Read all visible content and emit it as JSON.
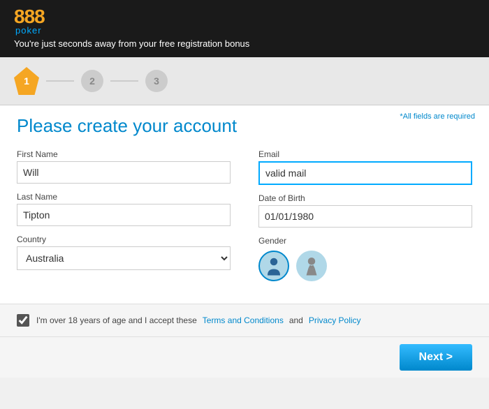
{
  "header": {
    "logo_888": "888",
    "logo_poker": "poker",
    "subtitle": "You're just seconds away from your free registration bonus"
  },
  "steps": {
    "step1": "1",
    "step2": "2",
    "step3": "3"
  },
  "form": {
    "required_note": "*All fields are required",
    "page_title": "Please create your account",
    "first_name_label": "First Name",
    "first_name_value": "Will",
    "last_name_label": "Last Name",
    "last_name_value": "Tipton",
    "country_label": "Country",
    "country_value": "Australia",
    "email_label": "Email",
    "email_value": "valid mail",
    "dob_label": "Date of Birth",
    "dob_value": "01/01/1980",
    "gender_label": "Gender"
  },
  "footer": {
    "checkbox_text": "I'm over 18 years of age and I accept these ",
    "terms_label": "Terms and Conditions",
    "and_text": " and ",
    "privacy_label": "Privacy Policy"
  },
  "button": {
    "next_label": "Next >"
  }
}
